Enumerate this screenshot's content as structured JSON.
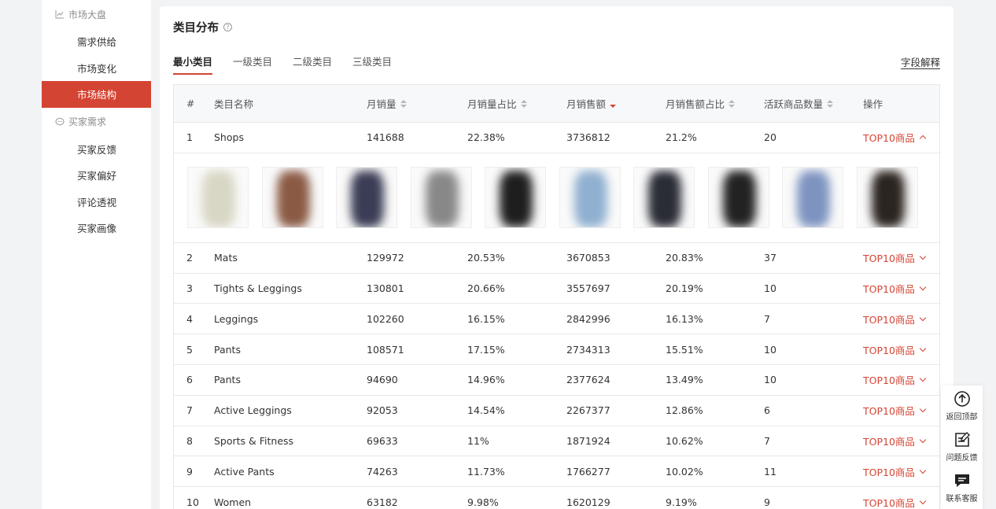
{
  "sidebar": {
    "groups": [
      {
        "label": "市场大盘",
        "icon": "chart-icon",
        "items": [
          "需求供给",
          "市场变化",
          "市场结构"
        ]
      },
      {
        "label": "买家需求",
        "icon": "chat-icon",
        "items": [
          "买家反馈",
          "买家偏好",
          "评论透视",
          "买家画像"
        ]
      }
    ],
    "active_item": "市场结构"
  },
  "card": {
    "title": "类目分布",
    "help_icon": "question-icon",
    "tabs": [
      "最小类目",
      "一级类目",
      "二级类目",
      "三级类目"
    ],
    "active_tab": "最小类目",
    "field_explain": "字段解释"
  },
  "table": {
    "headers": [
      "#",
      "类目名称",
      "月销量",
      "月销量占比",
      "月销售额",
      "月销售额占比",
      "活跃商品数量",
      "操作"
    ],
    "sorted_column": "月销售额",
    "sort_direction": "desc",
    "action_label": "TOP10商品",
    "expanded_row": 1,
    "rows": [
      {
        "idx": "1",
        "name": "Shops",
        "sales": "141688",
        "sales_pct": "22.38%",
        "revenue": "3736812",
        "revenue_pct": "21.2%",
        "active": "20"
      },
      {
        "idx": "2",
        "name": "Mats",
        "sales": "129972",
        "sales_pct": "20.53%",
        "revenue": "3670853",
        "revenue_pct": "20.83%",
        "active": "37"
      },
      {
        "idx": "3",
        "name": "Tights & Leggings",
        "sales": "130801",
        "sales_pct": "20.66%",
        "revenue": "3557697",
        "revenue_pct": "20.19%",
        "active": "10"
      },
      {
        "idx": "4",
        "name": "Leggings",
        "sales": "102260",
        "sales_pct": "16.15%",
        "revenue": "2842996",
        "revenue_pct": "16.13%",
        "active": "7"
      },
      {
        "idx": "5",
        "name": "Pants",
        "sales": "108571",
        "sales_pct": "17.15%",
        "revenue": "2734313",
        "revenue_pct": "15.51%",
        "active": "10"
      },
      {
        "idx": "6",
        "name": "Pants",
        "sales": "94690",
        "sales_pct": "14.96%",
        "revenue": "2377624",
        "revenue_pct": "13.49%",
        "active": "10"
      },
      {
        "idx": "7",
        "name": "Active Leggings",
        "sales": "92053",
        "sales_pct": "14.54%",
        "revenue": "2267377",
        "revenue_pct": "12.86%",
        "active": "6"
      },
      {
        "idx": "8",
        "name": "Sports & Fitness",
        "sales": "69633",
        "sales_pct": "11%",
        "revenue": "1871924",
        "revenue_pct": "10.62%",
        "active": "7"
      },
      {
        "idx": "9",
        "name": "Active Pants",
        "sales": "74263",
        "sales_pct": "11.73%",
        "revenue": "1766277",
        "revenue_pct": "10.02%",
        "active": "11"
      },
      {
        "idx": "10",
        "name": "Women",
        "sales": "63182",
        "sales_pct": "9.98%",
        "revenue": "1620129",
        "revenue_pct": "9.19%",
        "active": "9"
      }
    ],
    "thumbnail_colors": [
      "#d8d6c4",
      "#8a5a44",
      "#3a3d55",
      "#888888",
      "#1e1e1e",
      "#8fb0d0",
      "#2a2c36",
      "#222222",
      "#7d93c0",
      "#2b2420"
    ]
  },
  "float_tools": [
    {
      "label": "返回顶部",
      "icon": "arrow-up-circle-icon"
    },
    {
      "label": "问题反馈",
      "icon": "edit-note-icon"
    },
    {
      "label": "联系客服",
      "icon": "message-icon"
    }
  ],
  "colors": {
    "accent": "#d44433",
    "sidebar_bg": "#ffffff",
    "page_bg": "#f2f3f5"
  }
}
